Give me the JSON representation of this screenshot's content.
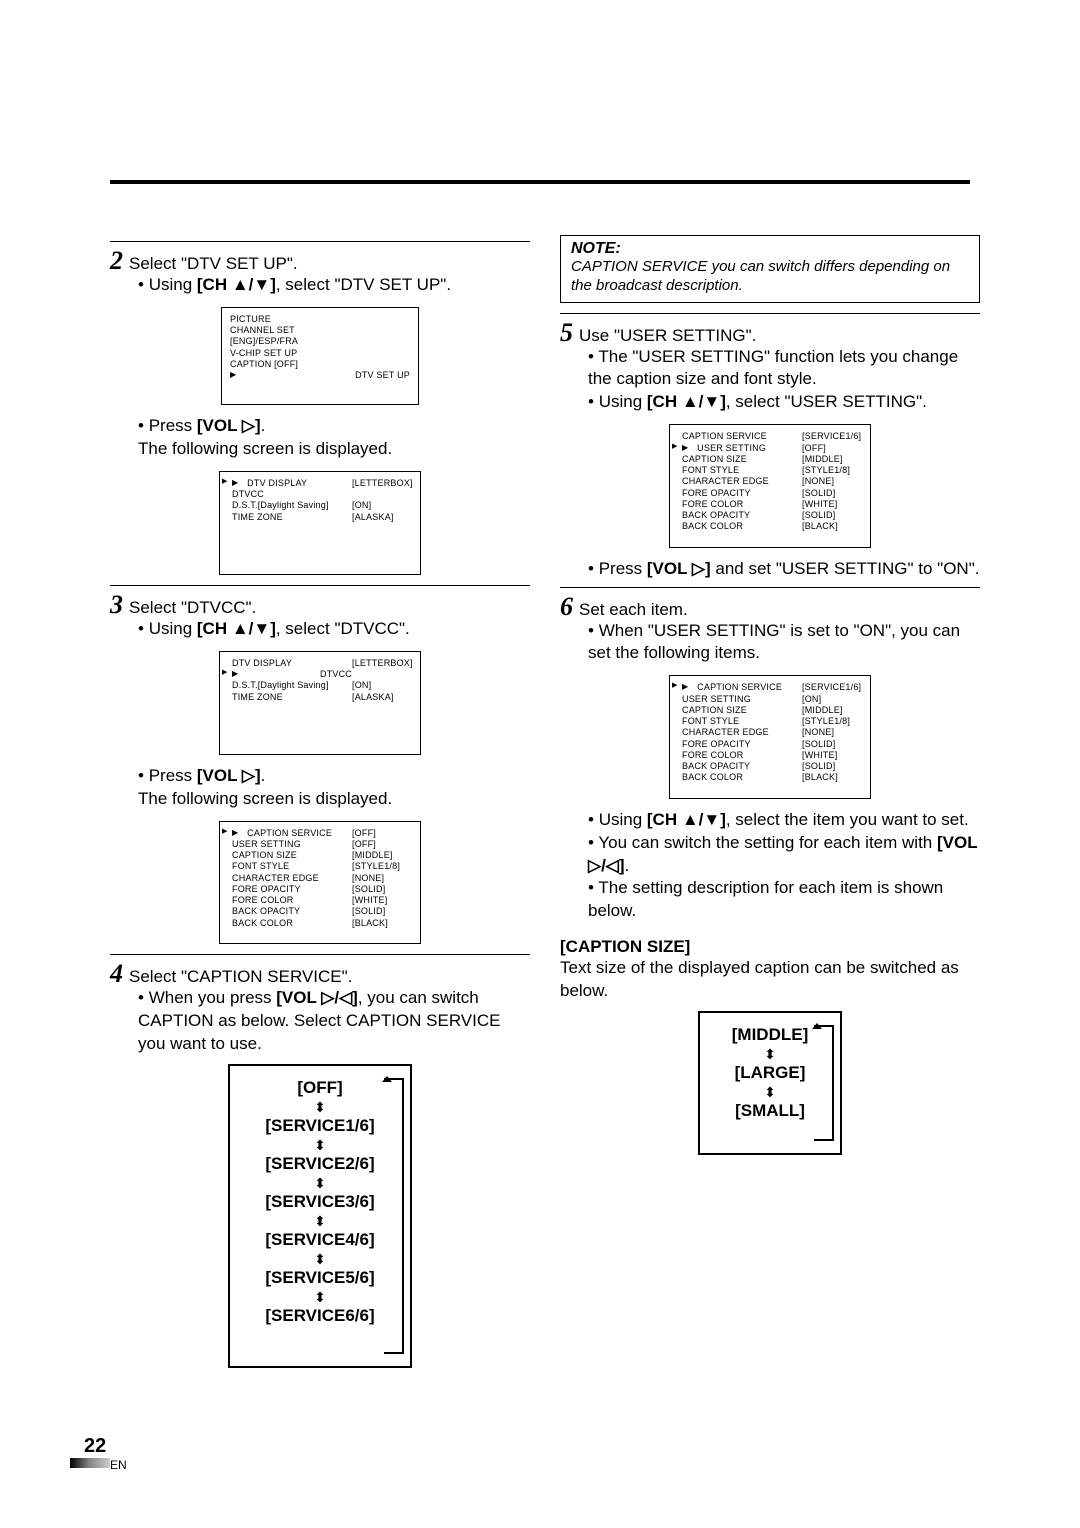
{
  "page_number": "22",
  "page_locale": "EN",
  "left": {
    "step2": {
      "title": "Select \"DTV SET UP\".",
      "b1_pre": "Using ",
      "b1_bold": "[CH ▲/▼]",
      "b1_post": ", select \"DTV SET UP\".",
      "osd1": [
        {
          "l": "PICTURE"
        },
        {
          "l": "CHANNEL SET"
        },
        {
          "l": "[ENG]/ESP/FRA"
        },
        {
          "l": "V-CHIP SET UP"
        },
        {
          "l": "CAPTION [OFF]"
        },
        {
          "l": "DTV SET UP",
          "sel": true
        }
      ],
      "b2_pre": "Press ",
      "b2_bold": "[VOL ▷]",
      "b2_post": ".",
      "b2_line2": "The following screen is displayed.",
      "osd2": [
        {
          "l": "DTV DISPLAY",
          "v": "[LETTERBOX]",
          "sel": true
        },
        {
          "l": "DTVCC"
        },
        {
          "l": "D.S.T.[Daylight Saving]",
          "v": "[ON]"
        },
        {
          "l": "TIME ZONE",
          "v": "[ALASKA]"
        }
      ]
    },
    "step3": {
      "title": "Select \"DTVCC\".",
      "b1_pre": "Using ",
      "b1_bold": "[CH ▲/▼]",
      "b1_post": ", select \"DTVCC\".",
      "osd1": [
        {
          "l": "DTV DISPLAY",
          "v": "[LETTERBOX]"
        },
        {
          "l": "DTVCC",
          "sel": true
        },
        {
          "l": "D.S.T.[Daylight Saving]",
          "v": "[ON]"
        },
        {
          "l": "TIME ZONE",
          "v": "[ALASKA]"
        }
      ],
      "b2_pre": "Press ",
      "b2_bold": "[VOL ▷]",
      "b2_post": ".",
      "b2_line2": "The following screen is displayed.",
      "osd2": [
        {
          "l": "CAPTION SERVICE",
          "v": "[OFF]",
          "sel": true
        },
        {
          "l": "USER SETTING",
          "v": "[OFF]"
        },
        {
          "l": "CAPTION SIZE",
          "v": "[MIDDLE]"
        },
        {
          "l": "FONT STYLE",
          "v": "[STYLE1/8]"
        },
        {
          "l": "CHARACTER EDGE",
          "v": "[NONE]"
        },
        {
          "l": "FORE OPACITY",
          "v": "[SOLID]"
        },
        {
          "l": "FORE COLOR",
          "v": "[WHITE]"
        },
        {
          "l": "BACK OPACITY",
          "v": "[SOLID]"
        },
        {
          "l": "BACK COLOR",
          "v": "[BLACK]"
        }
      ]
    },
    "step4": {
      "title": "Select \"CAPTION SERVICE\".",
      "b1_pre": "When you press ",
      "b1_bold": "[VOL ▷/◁]",
      "b1_post": ", you can switch CAPTION as below. Select CAPTION SERVICE you want to use.",
      "cycle": [
        "[OFF]",
        "[SERVICE1/6]",
        "[SERVICE2/6]",
        "[SERVICE3/6]",
        "[SERVICE4/6]",
        "[SERVICE5/6]",
        "[SERVICE6/6]"
      ]
    }
  },
  "right": {
    "note_title": "NOTE:",
    "note_text": "CAPTION SERVICE you can switch differs depending on the broadcast description.",
    "step5": {
      "title": "Use \"USER SETTING\".",
      "b1": "The \"USER SETTING\" function lets you change the caption size and font style.",
      "b2_pre": "Using ",
      "b2_bold": "[CH ▲/▼]",
      "b2_post": ", select \"USER SETTING\".",
      "osd": [
        {
          "l": "CAPTION SERVICE",
          "v": "[SERVICE1/6]"
        },
        {
          "l": "USER SETTING",
          "v": "[OFF]",
          "sel": true
        },
        {
          "l": "CAPTION SIZE",
          "v": "[MIDDLE]"
        },
        {
          "l": "FONT STYLE",
          "v": "[STYLE1/8]"
        },
        {
          "l": "CHARACTER EDGE",
          "v": "[NONE]"
        },
        {
          "l": "FORE OPACITY",
          "v": "[SOLID]"
        },
        {
          "l": "FORE COLOR",
          "v": "[WHITE]"
        },
        {
          "l": "BACK OPACITY",
          "v": "[SOLID]"
        },
        {
          "l": "BACK COLOR",
          "v": "[BLACK]"
        }
      ],
      "b3_pre": "Press ",
      "b3_bold": "[VOL ▷]",
      "b3_post": " and set \"USER SETTING\" to \"ON\"."
    },
    "step6": {
      "title": "Set each item.",
      "b1": "When \"USER SETTING\" is set to \"ON\", you can set the following items.",
      "osd": [
        {
          "l": "CAPTION SERVICE",
          "v": "[SERVICE1/6]",
          "sel": true
        },
        {
          "l": "USER SETTING",
          "v": "[ON]"
        },
        {
          "l": "CAPTION SIZE",
          "v": "[MIDDLE]"
        },
        {
          "l": "FONT STYLE",
          "v": "[STYLE1/8]"
        },
        {
          "l": "CHARACTER EDGE",
          "v": "[NONE]"
        },
        {
          "l": "FORE OPACITY",
          "v": "[SOLID]"
        },
        {
          "l": "FORE COLOR",
          "v": "[WHITE]"
        },
        {
          "l": "BACK OPACITY",
          "v": "[SOLID]"
        },
        {
          "l": "BACK COLOR",
          "v": "[BLACK]"
        }
      ],
      "b2_pre": "Using ",
      "b2_bold": "[CH ▲/▼]",
      "b2_post": ", select the item you want to set.",
      "b3_pre": "You can switch the setting for each item with ",
      "b3_bold": "[VOL ▷/◁]",
      "b3_post": ".",
      "b4": "The setting description for each item is shown below."
    },
    "caption_size": {
      "head": "[CAPTION SIZE]",
      "text": "Text size of the displayed caption can be switched as below.",
      "cycle": [
        "[MIDDLE]",
        "[LARGE]",
        "[SMALL]"
      ]
    }
  }
}
